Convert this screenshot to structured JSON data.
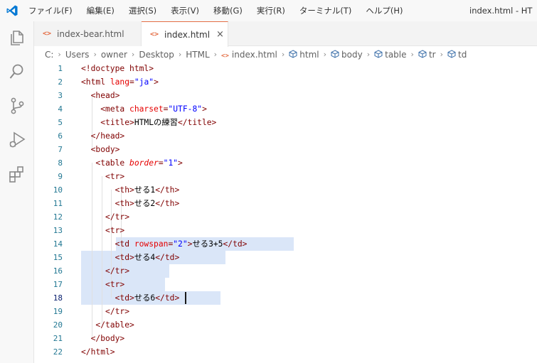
{
  "window_title": "index.html - HT",
  "menu": [
    "ファイル(F)",
    "編集(E)",
    "選択(S)",
    "表示(V)",
    "移動(G)",
    "実行(R)",
    "ターミナル(T)",
    "ヘルプ(H)"
  ],
  "activity_bar": [
    "explorer-icon",
    "search-icon",
    "source-control-icon",
    "run-debug-icon",
    "extensions-icon"
  ],
  "tabs": [
    {
      "label": "index-bear.html",
      "active": false
    },
    {
      "label": "index.html",
      "active": true,
      "close": "×"
    }
  ],
  "breadcrumbs": [
    "C:",
    "Users",
    "owner",
    "Desktop",
    "HTML",
    "index.html",
    "html",
    "body",
    "table",
    "tr",
    "td"
  ],
  "editor": {
    "active_line": 18,
    "lines": [
      {
        "n": "1",
        "tokens": [
          [
            "t",
            "<!doctype html>"
          ]
        ]
      },
      {
        "n": "2",
        "tokens": [
          [
            "t",
            "<html "
          ],
          [
            "a",
            "lang"
          ],
          [
            "p",
            "="
          ],
          [
            "s",
            "\"ja\""
          ],
          [
            "t",
            ">"
          ]
        ]
      },
      {
        "n": "3",
        "tokens": [
          [
            "x",
            "  "
          ],
          [
            "t",
            "<head>"
          ]
        ]
      },
      {
        "n": "4",
        "tokens": [
          [
            "x",
            "    "
          ],
          [
            "t",
            "<meta "
          ],
          [
            "a",
            "charset"
          ],
          [
            "p",
            "="
          ],
          [
            "s",
            "\"UTF-8\""
          ],
          [
            "t",
            ">"
          ]
        ]
      },
      {
        "n": "5",
        "tokens": [
          [
            "x",
            "    "
          ],
          [
            "t",
            "<title>"
          ],
          [
            "x",
            "HTMLの練習"
          ],
          [
            "t",
            "</title>"
          ]
        ]
      },
      {
        "n": "6",
        "tokens": [
          [
            "x",
            "  "
          ],
          [
            "t",
            "</head>"
          ]
        ]
      },
      {
        "n": "7",
        "tokens": [
          [
            "x",
            "  "
          ],
          [
            "t",
            "<body>"
          ]
        ]
      },
      {
        "n": "8",
        "tokens": [
          [
            "x",
            "   "
          ],
          [
            "t",
            "<table "
          ],
          [
            "i",
            "border"
          ],
          [
            "p",
            "="
          ],
          [
            "s",
            "\"1\""
          ],
          [
            "t",
            ">"
          ]
        ]
      },
      {
        "n": "9",
        "tokens": [
          [
            "x",
            "     "
          ],
          [
            "t",
            "<tr>"
          ]
        ]
      },
      {
        "n": "10",
        "tokens": [
          [
            "x",
            "       "
          ],
          [
            "t",
            "<th>"
          ],
          [
            "x",
            "せる1"
          ],
          [
            "t",
            "</th>"
          ]
        ]
      },
      {
        "n": "11",
        "tokens": [
          [
            "x",
            "       "
          ],
          [
            "t",
            "<th>"
          ],
          [
            "x",
            "せる2"
          ],
          [
            "t",
            "</th>"
          ]
        ]
      },
      {
        "n": "12",
        "tokens": [
          [
            "x",
            "     "
          ],
          [
            "t",
            "</tr>"
          ]
        ]
      },
      {
        "n": "13",
        "tokens": [
          [
            "x",
            "     "
          ],
          [
            "t",
            "<tr>"
          ]
        ]
      },
      {
        "n": "14",
        "tokens": [
          [
            "x",
            "       "
          ],
          [
            "t",
            "<td "
          ],
          [
            "a",
            "rowspan"
          ],
          [
            "p",
            "="
          ],
          [
            "s",
            "\"2\""
          ],
          [
            "t",
            ">"
          ],
          [
            "x",
            "せる3+5"
          ],
          [
            "t",
            "</td>"
          ]
        ]
      },
      {
        "n": "15",
        "tokens": [
          [
            "x",
            "       "
          ],
          [
            "t",
            "<td>"
          ],
          [
            "x",
            "せる4"
          ],
          [
            "t",
            "</td>"
          ]
        ]
      },
      {
        "n": "16",
        "tokens": [
          [
            "x",
            "     "
          ],
          [
            "t",
            "</tr>"
          ]
        ]
      },
      {
        "n": "17",
        "tokens": [
          [
            "x",
            "     "
          ],
          [
            "t",
            "<tr>"
          ]
        ]
      },
      {
        "n": "18",
        "tokens": [
          [
            "x",
            "       "
          ],
          [
            "t",
            "<td>"
          ],
          [
            "x",
            "せる6"
          ],
          [
            "t",
            "</td>"
          ]
        ]
      },
      {
        "n": "19",
        "tokens": [
          [
            "x",
            "     "
          ],
          [
            "t",
            "</tr>"
          ]
        ]
      },
      {
        "n": "20",
        "tokens": [
          [
            "x",
            "   "
          ],
          [
            "t",
            "</table>"
          ]
        ]
      },
      {
        "n": "21",
        "tokens": [
          [
            "x",
            "  "
          ],
          [
            "t",
            "</body>"
          ]
        ]
      },
      {
        "n": "22",
        "tokens": [
          [
            "t",
            "</html>"
          ]
        ]
      }
    ]
  },
  "colors": {
    "accent_tab_border": "#e46e45",
    "selection": "#dae6f8",
    "tag": "#800000",
    "attribute": "#e50000",
    "string": "#0000ff",
    "line_number": "#237893"
  }
}
